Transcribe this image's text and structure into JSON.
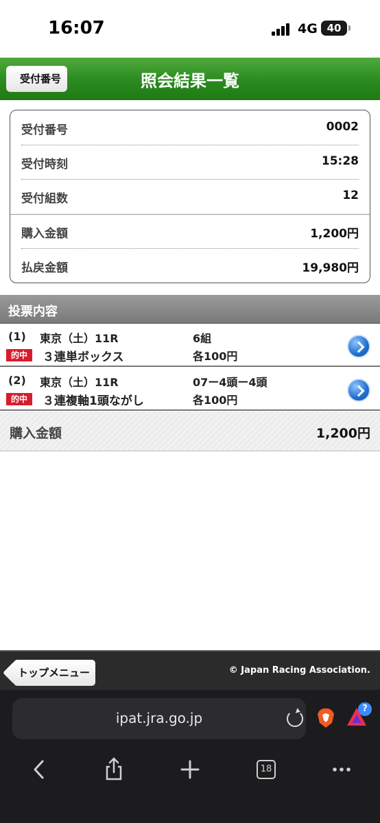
{
  "status_bar": {
    "time": "16:07",
    "network": "4G",
    "battery": "40"
  },
  "header": {
    "back_label": "受付番号",
    "title": "照会結果一覧"
  },
  "receipt": {
    "rows": [
      {
        "label": "受付番号",
        "value": "0002"
      },
      {
        "label": "受付時刻",
        "value": "15:28"
      },
      {
        "label": "受付組数",
        "value": "12"
      },
      {
        "label": "購入金額",
        "value": "1,200円"
      },
      {
        "label": "払戻金額",
        "value": "19,980円"
      }
    ]
  },
  "votes": {
    "section_title": "投票内容",
    "items": [
      {
        "num": "(1)",
        "race": "東京（土）11R",
        "count": "6組",
        "hit": "的中",
        "type": "３連単ボックス",
        "amount": "各100円"
      },
      {
        "num": "(2)",
        "race": "東京（土）11R",
        "count": "07ー4頭ー4頭",
        "hit": "的中",
        "type": "３連複軸1頭ながし",
        "amount": "各100円"
      }
    ]
  },
  "total": {
    "label": "購入金額",
    "value": "1,200円"
  },
  "footer": {
    "top_menu_label": "トップメニュー",
    "copyright": "© Japan Racing Association."
  },
  "browser": {
    "url": "ipat.jra.go.jp",
    "tab_count": "18",
    "question_badge": "?"
  },
  "colors": {
    "header_green": "#2a8a1f",
    "hit_red": "#d81c2c",
    "arrow_blue": "#1f6fd0"
  },
  "icons": [
    "signal-icon",
    "battery-icon",
    "chevron-right-icon",
    "reload-icon",
    "brave-lion-icon",
    "bat-icon",
    "back-icon",
    "share-icon",
    "plus-icon",
    "tabs-icon",
    "more-icon"
  ]
}
